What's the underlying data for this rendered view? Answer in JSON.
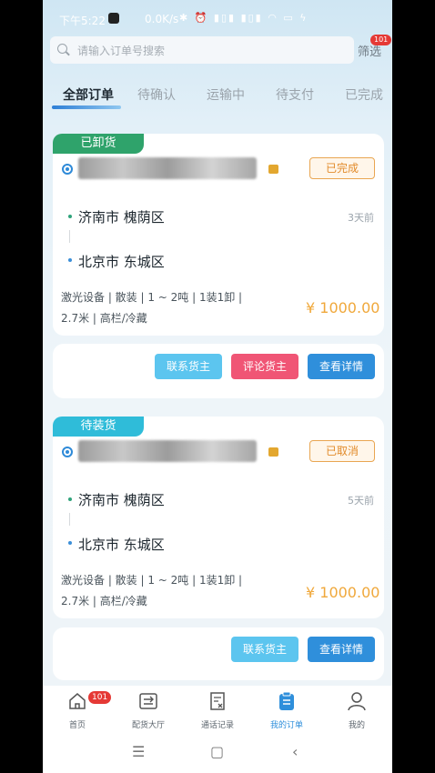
{
  "status_bar": {
    "time": "下午5:22",
    "speed": "0.0K/s",
    "icons": "✱ ⏰ ▮▯▮ ▮▯▮ ◠ ▭ ϟ"
  },
  "search": {
    "placeholder": "请输入订单号搜索"
  },
  "filter": {
    "label": "筛选",
    "badge": "101"
  },
  "tabs": [
    {
      "label": "全部订单",
      "active": true
    },
    {
      "label": "待确认"
    },
    {
      "label": "运输中"
    },
    {
      "label": "待支付"
    },
    {
      "label": "已完成"
    }
  ],
  "orders": [
    {
      "status_tag": "已卸货",
      "status_tag_color": "#2fa36b",
      "status": "已完成",
      "from": "济南市 槐荫区",
      "to": "北京市 东城区",
      "days": "3天前",
      "spec_line1": "激光设备 | 散装 | 1 ~ 2吨 | 1装1卸 |",
      "spec_line2": "2.7米 | 高栏/冷藏",
      "price": "¥ 1000.00",
      "buttons": {
        "contact": "联系货主",
        "review": "评论货主",
        "detail": "查看详情"
      }
    },
    {
      "status_tag": "待装货",
      "status_tag_color": "#2fbcd9",
      "status": "已取消",
      "from": "济南市 槐荫区",
      "to": "北京市 东城区",
      "days": "5天前",
      "spec_line1": "激光设备 | 散装 | 1 ~ 2吨 | 1装1卸 |",
      "spec_line2": "2.7米 | 高栏/冷藏",
      "price": "¥ 1000.00",
      "buttons": {
        "contact": "联系货主",
        "detail": "查看详情"
      }
    }
  ],
  "tabbar": {
    "items": [
      {
        "label": "首页",
        "icon": "home-icon",
        "badge": "101"
      },
      {
        "label": "配货大厅",
        "icon": "cargo-hall-icon"
      },
      {
        "label": "通话记录",
        "icon": "call-record-icon"
      },
      {
        "label": "我的订单",
        "icon": "orders-icon",
        "active": true
      },
      {
        "label": "我的",
        "icon": "profile-icon"
      }
    ]
  },
  "colors": {
    "accent": "#2f8fdb",
    "price": "#f0a83b",
    "review": "#f05575"
  }
}
